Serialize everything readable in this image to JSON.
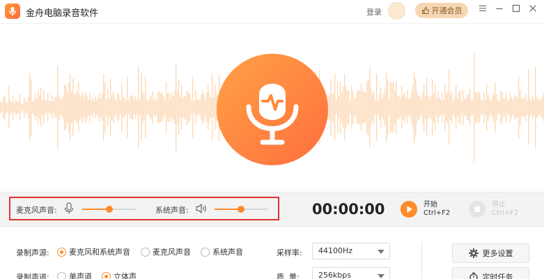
{
  "titlebar": {
    "title": "金舟电脑录音软件",
    "login_label": "登录",
    "vip_label": "开通会员",
    "menu_icon": "menu-icon",
    "minimize_icon": "minimize-icon",
    "maximize_icon": "maximize-icon",
    "close_icon": "close-icon"
  },
  "colors": {
    "accent": "#ff8a2a",
    "mic_gradient_start": "#ffa245",
    "mic_gradient_end": "#ff6e3e",
    "waveform": "#fcd9b6",
    "highlight_border": "#e0322c",
    "vip_background": "#f6d7b5"
  },
  "controls": {
    "mic_volume_label": "麦克风声音:",
    "mic_volume": 0.5,
    "system_volume_label": "系统声音:",
    "system_volume": 0.5,
    "timer": "00:00:00",
    "start_label": "开始",
    "start_shortcut": "Ctrl+F2",
    "stop_label": "停止",
    "stop_shortcut": "Ctrl+F2"
  },
  "settings": {
    "source_label": "录制声源:",
    "source_options": [
      "麦克风和系统声音",
      "麦克风声音",
      "系统声音"
    ],
    "source_selected": 0,
    "channel_label": "录制声道:",
    "channel_options": [
      "单声道",
      "立体声"
    ],
    "channel_selected": 1,
    "sample_rate_label": "采样率:",
    "sample_rate_value": "44100Hz",
    "quality_label": "质  量:",
    "quality_value": "256kbps",
    "more_settings_label": "更多设置",
    "scheduled_task_label": "定时任务"
  }
}
